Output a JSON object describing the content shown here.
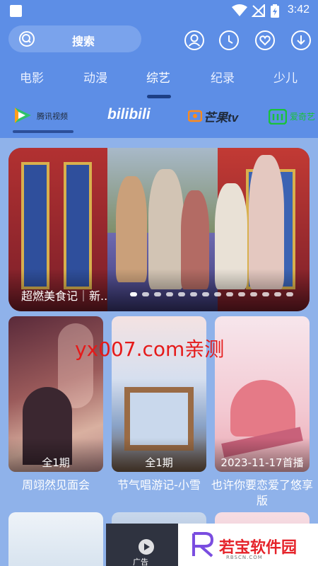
{
  "status_bar": {
    "time": "3:42"
  },
  "search": {
    "label": "搜索"
  },
  "tabs": [
    {
      "label": "电影"
    },
    {
      "label": "动漫"
    },
    {
      "label": "综艺",
      "active": true
    },
    {
      "label": "纪录"
    },
    {
      "label": "少儿"
    }
  ],
  "platforms": [
    {
      "label": "腾讯视频",
      "icon": "tencent-video-logo"
    },
    {
      "label": "bilibili",
      "icon": "bilibili-logo"
    },
    {
      "label": "芒果tv",
      "icon": "mango-tv-logo"
    },
    {
      "label": "爱奇艺",
      "icon": "iqiyi-logo"
    }
  ],
  "banner": {
    "caption": "超燃美食记｜新..",
    "dot_count": 14,
    "active_dot": 0
  },
  "cards": [
    {
      "title": "周翊然见面会",
      "badge": "全1期"
    },
    {
      "title": "节气唱游记-小雪",
      "badge": "全1期"
    },
    {
      "title": "也许你要恋爱了悠享版",
      "badge": "2023-11-17首播"
    }
  ],
  "watermark": "yx007.com亲测",
  "ad": {
    "label": "广告",
    "brand": "若宝软件园",
    "sub": "RBSCN.COM"
  },
  "colors": {
    "header_bg": "#5d8ee6",
    "page_bg": "#8fb2ea",
    "tab_indicator": "#1d3f86",
    "watermark": "#e51a1a"
  }
}
